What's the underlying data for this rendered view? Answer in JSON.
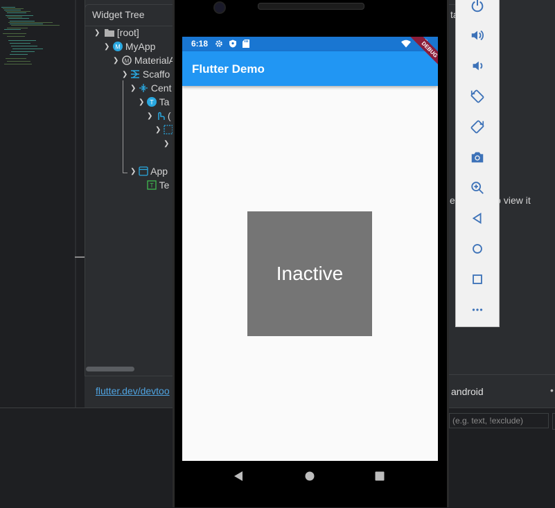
{
  "ide": {
    "widget_tree_title": "Widget Tree",
    "tree_nodes": [
      {
        "label": "[root]",
        "icon": "folder-icon"
      },
      {
        "label": "MyApp",
        "icon": "stateless-widget-icon"
      },
      {
        "label": "MaterialA",
        "icon": "material-app-icon"
      },
      {
        "label": "Scaffo",
        "icon": "scaffold-icon"
      },
      {
        "label": "Cent",
        "icon": "center-icon"
      },
      {
        "label": "Ta",
        "icon": "stateful-widget-icon"
      },
      {
        "label": "(",
        "icon": "gesture-detector-icon"
      },
      {
        "label": "",
        "icon": "container-icon"
      },
      {
        "label": "",
        "icon": "chevron-icon"
      },
      {
        "label": "App",
        "icon": "app-bar-icon"
      },
      {
        "label": "Te",
        "icon": "text-widget-icon"
      }
    ],
    "devtools_link": "flutter.dev/devtoo",
    "right_tab_fragment": "ta",
    "hint_text": "e      dget to view it",
    "device_label": "android",
    "more_label": "•",
    "filter_placeholder": "(e.g. text, !exclude)"
  },
  "device": {
    "status_time": "6:18",
    "app_title": "Flutter Demo",
    "debug_banner": "DEBUG",
    "box_label": "Inactive",
    "box_color": "#757575",
    "app_bar_color": "#2196f3",
    "status_bar_color": "#1976d2"
  },
  "emulator_toolbar": {
    "buttons": [
      "power-icon",
      "volume-up-icon",
      "volume-down-icon",
      "rotate-left-icon",
      "rotate-right-icon",
      "camera-icon",
      "zoom-icon",
      "back-icon",
      "home-icon",
      "overview-icon",
      "more-icon"
    ]
  }
}
